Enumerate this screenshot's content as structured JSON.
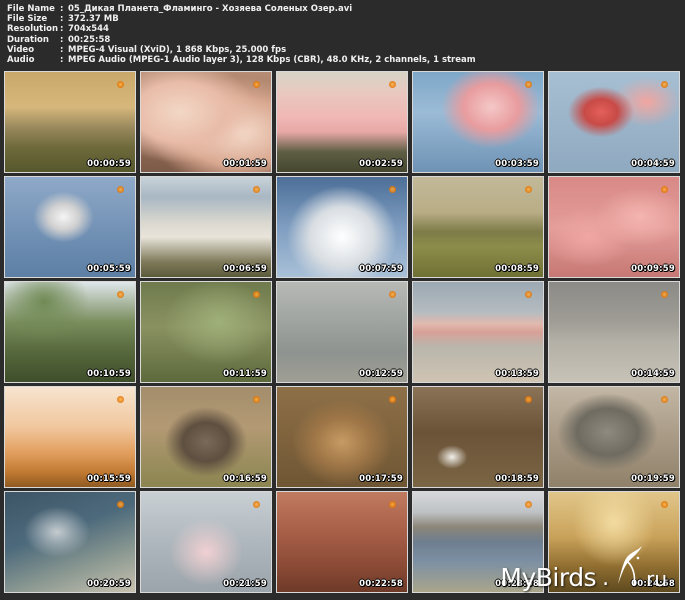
{
  "info": [
    {
      "key": "File Name",
      "value": "05_Дикая Планета_Фламинго - Хозяева Соленых Озер.avi"
    },
    {
      "key": "File Size",
      "value": "372.37 MB"
    },
    {
      "key": "Resolution",
      "value": "704x544"
    },
    {
      "key": "Duration",
      "value": "00:25:58"
    },
    {
      "key": "Video",
      "value": "MPEG-4 Visual (XviD), 1 868 Kbps, 25.000 fps"
    },
    {
      "key": "Audio",
      "value": "MPEG Audio (MPEG-1 Audio layer 3), 128 Kbps (CBR), 48.0 KHz, 2 channels, 1 stream"
    }
  ],
  "separator": ":",
  "thumbnails": [
    {
      "time": "00:00:59",
      "scene": "misty-lake"
    },
    {
      "time": "00:01:59",
      "scene": "flamingo-closeup"
    },
    {
      "time": "00:02:59",
      "scene": "flamingo-flock"
    },
    {
      "time": "00:03:59",
      "scene": "flamingos-water"
    },
    {
      "time": "00:04:59",
      "scene": "flamingos-walking"
    },
    {
      "time": "00:05:59",
      "scene": "pelican-landing"
    },
    {
      "time": "00:06:59",
      "scene": "pelicans-group"
    },
    {
      "time": "00:07:59",
      "scene": "pelicans-flying"
    },
    {
      "time": "00:08:59",
      "scene": "waterbuck"
    },
    {
      "time": "00:09:59",
      "scene": "flamingo-crowd"
    },
    {
      "time": "00:10:59",
      "scene": "acacia-trees"
    },
    {
      "time": "00:11:59",
      "scene": "forest-branches"
    },
    {
      "time": "00:12:59",
      "scene": "bird-flight-lake"
    },
    {
      "time": "00:13:59",
      "scene": "flamingo-line"
    },
    {
      "time": "00:14:59",
      "scene": "hazy-lake"
    },
    {
      "time": "00:15:59",
      "scene": "sunset-birds"
    },
    {
      "time": "00:16:59",
      "scene": "warthog"
    },
    {
      "time": "00:17:59",
      "scene": "hyena-grass"
    },
    {
      "time": "00:18:59",
      "scene": "vultures-egret"
    },
    {
      "time": "00:19:59",
      "scene": "rhino"
    },
    {
      "time": "00:20:59",
      "scene": "aerial-shore"
    },
    {
      "time": "00:21:59",
      "scene": "flamingos-pale"
    },
    {
      "time": "00:22:58",
      "scene": "flamingo-necks"
    },
    {
      "time": "00:23:58",
      "scene": "mountain-lake"
    },
    {
      "time": "00:24:58",
      "scene": "golden-grass"
    }
  ],
  "watermark": {
    "brand": "MyBirds",
    "dot": ".",
    "tld": "ru"
  }
}
